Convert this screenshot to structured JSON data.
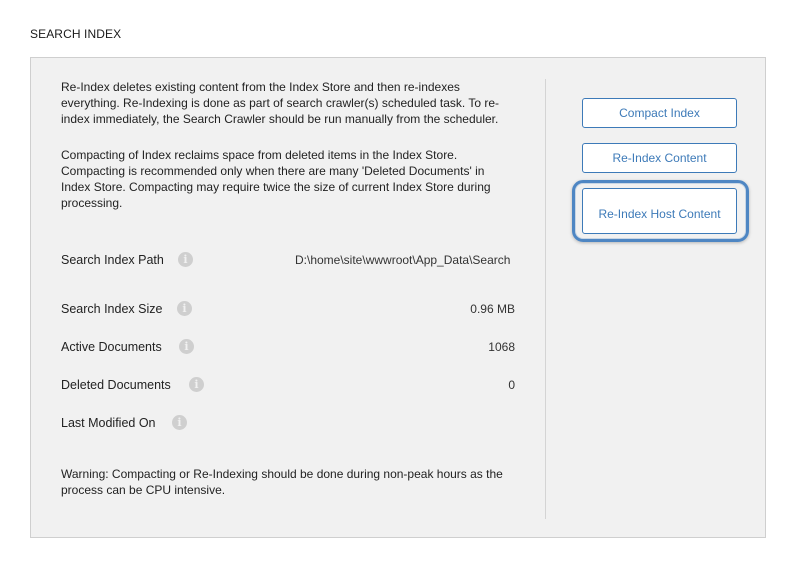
{
  "section": {
    "title": "SEARCH INDEX"
  },
  "description": {
    "reindex": "Re-Index deletes existing content from the Index Store and then re-indexes everything. Re-Indexing is done as part of search crawler(s) scheduled task. To re-index immediately, the Search Crawler should be run manually from the scheduler.",
    "compact": "Compacting of Index reclaims space from deleted items in the Index Store. Compacting is recommended only when there are many 'Deleted Documents' in Index Store. Compacting may require twice the size of current Index Store during processing."
  },
  "fields": {
    "path": {
      "label": "Search Index Path",
      "value": "D:\\home\\site\\wwwroot\\App_Data\\Search",
      "icon": "info-icon"
    },
    "size": {
      "label": "Search Index Size",
      "value": "0.96 MB",
      "icon": "info-icon"
    },
    "active": {
      "label": "Active Documents",
      "value": "1068",
      "icon": "info-icon"
    },
    "deleted": {
      "label": "Deleted Documents",
      "value": "0",
      "icon": "info-icon"
    },
    "modified": {
      "label": "Last Modified On",
      "value": "",
      "icon": "info-icon"
    }
  },
  "warning": "Warning: Compacting or Re-Indexing should be done during non-peak hours as the process can be CPU intensive.",
  "buttons": {
    "compact": "Compact Index",
    "reindex_content": "Re-Index Content",
    "reindex_host": "Re-Index Host Content"
  },
  "colors": {
    "accent": "#3d7ab8",
    "focus_ring": "#4e86c3",
    "panel_bg": "#f1f1f1"
  }
}
